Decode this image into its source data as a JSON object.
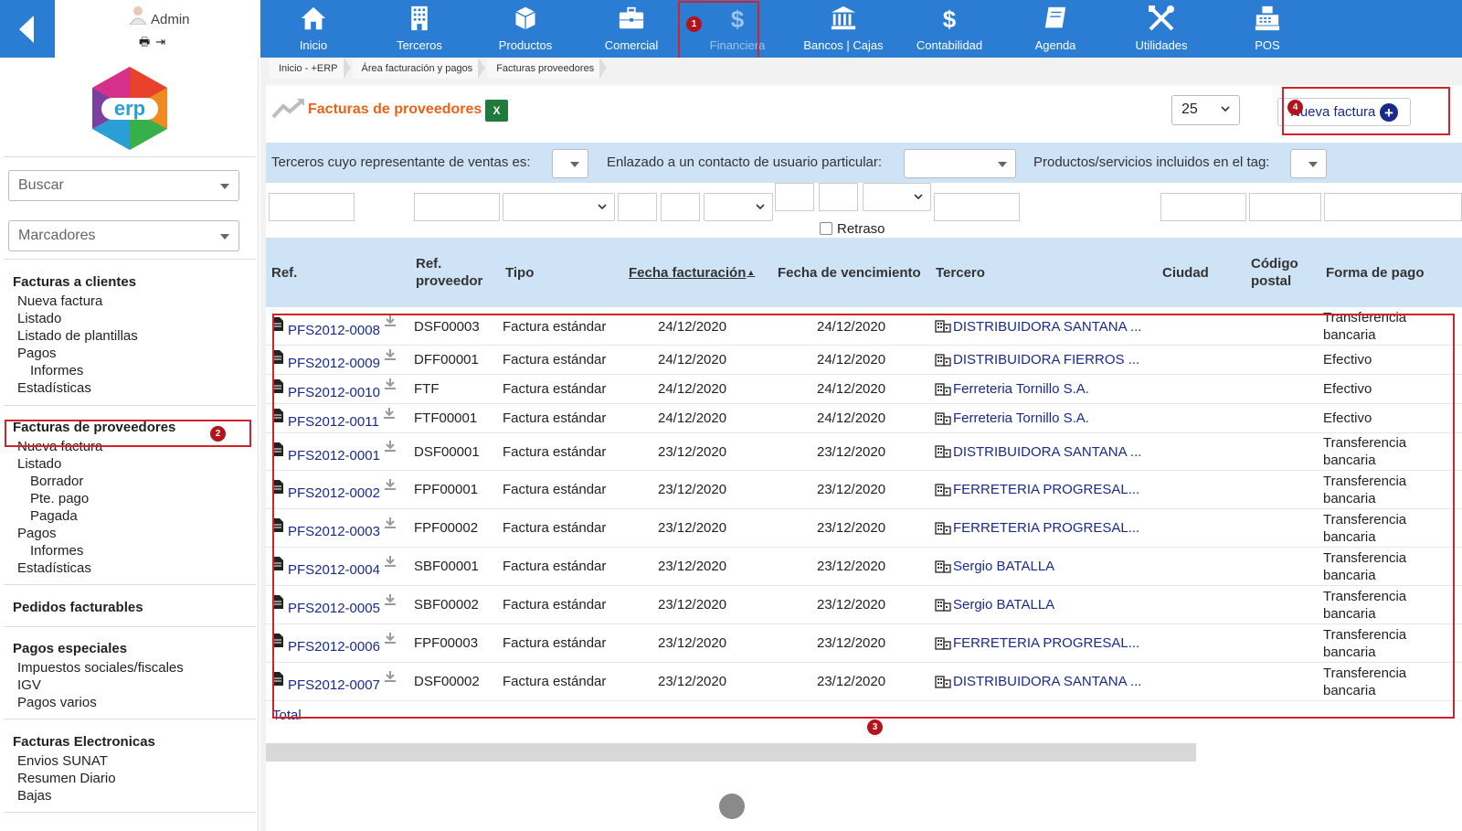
{
  "user": {
    "name": "Admin"
  },
  "topnav": {
    "items": [
      {
        "label": "Inicio",
        "icon": "home-icon"
      },
      {
        "label": "Terceros",
        "icon": "building-icon"
      },
      {
        "label": "Productos",
        "icon": "box-icon"
      },
      {
        "label": "Comercial",
        "icon": "briefcase-icon"
      },
      {
        "label": "Financiera",
        "icon": "dollar-icon",
        "active": true
      },
      {
        "label": "Bancos | Cajas",
        "icon": "bank-icon"
      },
      {
        "label": "Contabilidad",
        "icon": "dollar-icon"
      },
      {
        "label": "Agenda",
        "icon": "book-icon"
      },
      {
        "label": "Utilidades",
        "icon": "tools-icon"
      },
      {
        "label": "POS",
        "icon": "cash-register-icon"
      }
    ]
  },
  "annotations": {
    "b1": "1",
    "b2": "2",
    "b3": "3",
    "b4": "4"
  },
  "sidebar": {
    "search_placeholder": "Buscar",
    "bookmarks_placeholder": "Marcadores",
    "clientes": {
      "title": "Facturas a clientes",
      "items": [
        "Nueva factura",
        "Listado",
        "Listado de plantillas",
        "Pagos",
        "Informes",
        "Estadísticas"
      ]
    },
    "proveedores": {
      "title": "Facturas de proveedores",
      "items": [
        "Nueva factura",
        "Listado",
        "Borrador",
        "Pte. pago",
        "Pagada",
        "Pagos",
        "Informes",
        "Estadísticas"
      ]
    },
    "pedidos": {
      "title": "Pedidos facturables"
    },
    "especiales": {
      "title": "Pagos especiales",
      "items": [
        "Impuestos sociales/fiscales",
        "IGV",
        "Pagos varios"
      ]
    },
    "electronicas": {
      "title": "Facturas Electronicas",
      "items": [
        "Envios SUNAT",
        "Resumen Diario",
        "Bajas"
      ]
    }
  },
  "breadcrumb": [
    "Inicio - +ERP",
    "Área facturación y pagos",
    "Facturas proveedores"
  ],
  "page": {
    "title": "Facturas de proveedores",
    "limit": "25",
    "new_button": "Nueva factura"
  },
  "filters": {
    "sales_rep": "Terceros cuyo representante de ventas es:",
    "contact": "Enlazado a un contacto de usuario particular:",
    "tag": "Productos/servicios incluidos en el tag:",
    "late_label": "Retraso"
  },
  "table": {
    "headers": {
      "ref": "Ref.",
      "ref_supplier_1": "Ref.",
      "ref_supplier_2": "proveedor",
      "type": "Tipo",
      "date": "Fecha facturación",
      "due": "Fecha de vencimiento",
      "party": "Tercero",
      "city": "Ciudad",
      "zip_1": "Código",
      "zip_2": "postal",
      "payment": "Forma de pago"
    },
    "rows": [
      {
        "ref": "PFS2012-0008",
        "ref_supplier": "DSF00003",
        "type": "Factura estándar",
        "date": "24/12/2020",
        "due": "24/12/2020",
        "party": "DISTRIBUIDORA SANTANA ...",
        "pay1": "Transferencia",
        "pay2": "bancaria"
      },
      {
        "ref": "PFS2012-0009",
        "ref_supplier": "DFF00001",
        "type": "Factura estándar",
        "date": "24/12/2020",
        "due": "24/12/2020",
        "party": "DISTRIBUIDORA FIERROS ...",
        "pay1": "Efectivo",
        "pay2": ""
      },
      {
        "ref": "PFS2012-0010",
        "ref_supplier": "FTF",
        "type": "Factura estándar",
        "date": "24/12/2020",
        "due": "24/12/2020",
        "party": "Ferreteria Tornillo S.A.",
        "pay1": "Efectivo",
        "pay2": ""
      },
      {
        "ref": "PFS2012-0011",
        "ref_supplier": "FTF00001",
        "type": "Factura estándar",
        "date": "24/12/2020",
        "due": "24/12/2020",
        "party": "Ferreteria Tornillo S.A.",
        "pay1": "Efectivo",
        "pay2": ""
      },
      {
        "ref": "PFS2012-0001",
        "ref_supplier": "DSF00001",
        "type": "Factura estándar",
        "date": "23/12/2020",
        "due": "23/12/2020",
        "party": "DISTRIBUIDORA SANTANA ...",
        "pay1": "Transferencia",
        "pay2": "bancaria"
      },
      {
        "ref": "PFS2012-0002",
        "ref_supplier": "FPF00001",
        "type": "Factura estándar",
        "date": "23/12/2020",
        "due": "23/12/2020",
        "party": "FERRETERIA PROGRESAL...",
        "pay1": "Transferencia",
        "pay2": "bancaria"
      },
      {
        "ref": "PFS2012-0003",
        "ref_supplier": "FPF00002",
        "type": "Factura estándar",
        "date": "23/12/2020",
        "due": "23/12/2020",
        "party": "FERRETERIA PROGRESAL...",
        "pay1": "Transferencia",
        "pay2": "bancaria"
      },
      {
        "ref": "PFS2012-0004",
        "ref_supplier": "SBF00001",
        "type": "Factura estándar",
        "date": "23/12/2020",
        "due": "23/12/2020",
        "party": "Sergio BATALLA",
        "pay1": "Transferencia",
        "pay2": "bancaria"
      },
      {
        "ref": "PFS2012-0005",
        "ref_supplier": "SBF00002",
        "type": "Factura estándar",
        "date": "23/12/2020",
        "due": "23/12/2020",
        "party": "Sergio BATALLA",
        "pay1": "Transferencia",
        "pay2": "bancaria"
      },
      {
        "ref": "PFS2012-0006",
        "ref_supplier": "FPF00003",
        "type": "Factura estándar",
        "date": "23/12/2020",
        "due": "23/12/2020",
        "party": "FERRETERIA PROGRESAL...",
        "pay1": "Transferencia",
        "pay2": "bancaria"
      },
      {
        "ref": "PFS2012-0007",
        "ref_supplier": "DSF00002",
        "type": "Factura estándar",
        "date": "23/12/2020",
        "due": "23/12/2020",
        "party": "DISTRIBUIDORA SANTANA ...",
        "pay1": "Transferencia",
        "pay2": "bancaria"
      }
    ],
    "total_label": "Total"
  },
  "colors": {
    "accent": "#2b7cd3",
    "header_bg": "#cfe3f6",
    "link": "#1a2a8a",
    "title": "#e8641b",
    "highlight": "#d0232b"
  }
}
